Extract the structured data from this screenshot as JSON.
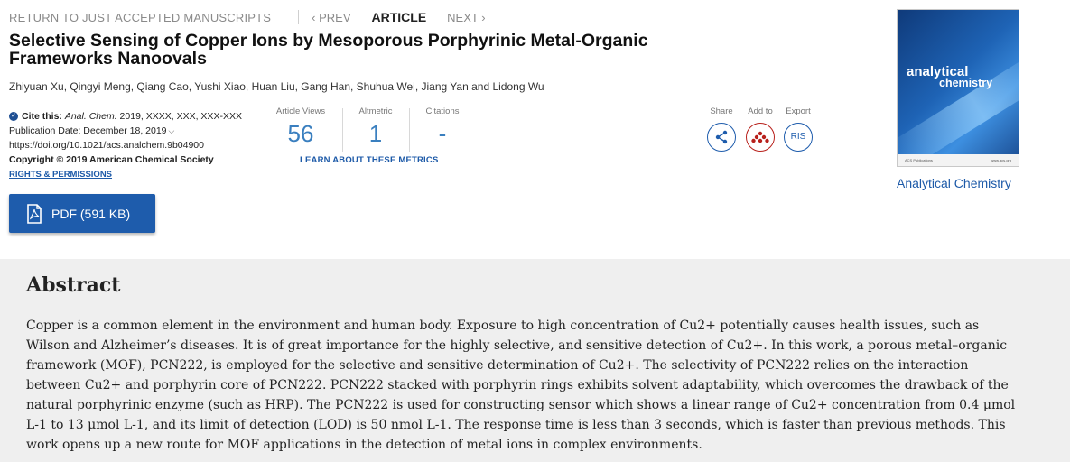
{
  "nav": {
    "back_label": "RETURN TO JUST ACCEPTED MANUSCRIPTS",
    "prev_label": "‹ PREV",
    "current_label": "ARTICLE",
    "next_label": "NEXT ›"
  },
  "article": {
    "title": "Selective Sensing of Copper Ions by Mesoporous Porphyrinic Metal-Organic Frameworks Nanoovals",
    "authors": "Zhiyuan Xu, Qingyi Meng, Qiang Cao, Yushi Xiao, Huan Liu, Gang Han, Shuhua Wei, Jiang Yan and Lidong Wu"
  },
  "citation": {
    "cite_label": "Cite this:",
    "journal": "Anal. Chem.",
    "ref": "2019, XXXX, XXX, XXX-XXX",
    "pub_date": "Publication Date: December 18, 2019",
    "doi": "https://doi.org/10.1021/acs.analchem.9b04900",
    "copyright": "Copyright © 2019 American Chemical Society",
    "rights": "RIGHTS & PERMISSIONS"
  },
  "pdf_button": {
    "label": "PDF (591 KB)"
  },
  "metrics": {
    "views_label": "Article Views",
    "views_value": "56",
    "altmetric_label": "Altmetric",
    "altmetric_value": "1",
    "citations_label": "Citations",
    "citations_value": "-",
    "learn_more": "LEARN ABOUT THESE METRICS"
  },
  "actions": {
    "share_label": "Share",
    "add_label": "Add to",
    "export_label": "Export",
    "export_button_text": "RIS"
  },
  "journal_cover": {
    "title_line1": "analytical",
    "title_line2": "chemistry",
    "footer_left": "ACS Publications",
    "footer_right": "www.acs.org"
  },
  "journal_link": "Analytical Chemistry",
  "abstract": {
    "heading": "Abstract",
    "text": "Copper is a common element in the environment and human body. Exposure to high concentration of Cu2+ potentially causes health issues, such as Wilson and Alzheimer’s diseases. It is of great importance for the highly selective, and sensitive detection of Cu2+. In this work, a porous metal–organic framework (MOF), PCN222, is employed for the selective and sensitive determination of Cu2+. The selectivity of PCN222 relies on the interaction between Cu2+ and porphyrin core of PCN222. PCN222 stacked with porphyrin rings exhibits solvent adaptability, which overcomes the drawback of the natural porphyrinic enzyme (such as HRP). The PCN222 is used for constructing sensor which shows a linear range of Cu2+ concentration from 0.4 μmol L-1 to 13 μmol L-1, and its limit of detection (LOD) is 50 nmol L-1. The response time is less than 3 seconds, which is faster than previous methods. This work opens up a new route for MOF applications in the detection of metal ions in complex environments."
  },
  "colors": {
    "link_blue": "#1d5aa8",
    "button_blue": "#1e5cac",
    "metric_blue": "#3a7fbf",
    "add_to_red": "#b8211c",
    "abstract_bg": "#efefef"
  },
  "icons": [
    "check-circle-icon",
    "chevron-down-icon",
    "pdf-icon",
    "share-icon",
    "mendeley-icon"
  ]
}
